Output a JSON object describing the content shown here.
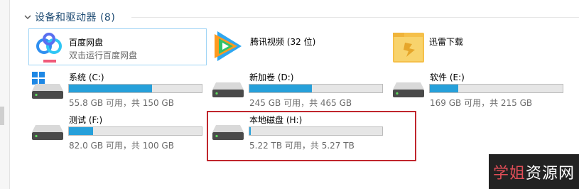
{
  "group": {
    "title": "设备和驱动器 (8)"
  },
  "apps": [
    {
      "name": "百度网盘",
      "subtitle": "双击运行百度网盘",
      "icon": "baidu-netdisk-icon"
    },
    {
      "name": "腾讯视频 (32 位)",
      "icon": "tencent-video-icon"
    },
    {
      "name": "迅雷下载",
      "icon": "thunder-folder-icon"
    }
  ],
  "drives": [
    {
      "label": "系统 (C:)",
      "info": "55.8 GB 可用，共 150 GB",
      "used_fraction": 0.628,
      "icon": "windows-drive-icon"
    },
    {
      "label": "新加卷 (D:)",
      "info": "245 GB 可用，共 465 GB",
      "used_fraction": 0.473,
      "icon": "hard-drive-icon"
    },
    {
      "label": "软件 (E:)",
      "info": "169 GB 可用，共 215 GB",
      "used_fraction": 0.214,
      "icon": "hard-drive-icon"
    },
    {
      "label": "测试 (F:)",
      "info": "82.0 GB 可用，共 100 GB",
      "used_fraction": 0.18,
      "icon": "hard-drive-icon"
    },
    {
      "label": "本地磁盘 (H:)",
      "info": "5.22 TB 可用，共 5.27 TB",
      "used_fraction": 0.01,
      "icon": "hard-drive-icon"
    }
  ],
  "watermark": {
    "part1": "学姐",
    "part2": "资源网"
  },
  "colors": {
    "bar_fill": "#26a0da",
    "highlight": "#c0262d",
    "title_text": "#1e4b73"
  }
}
